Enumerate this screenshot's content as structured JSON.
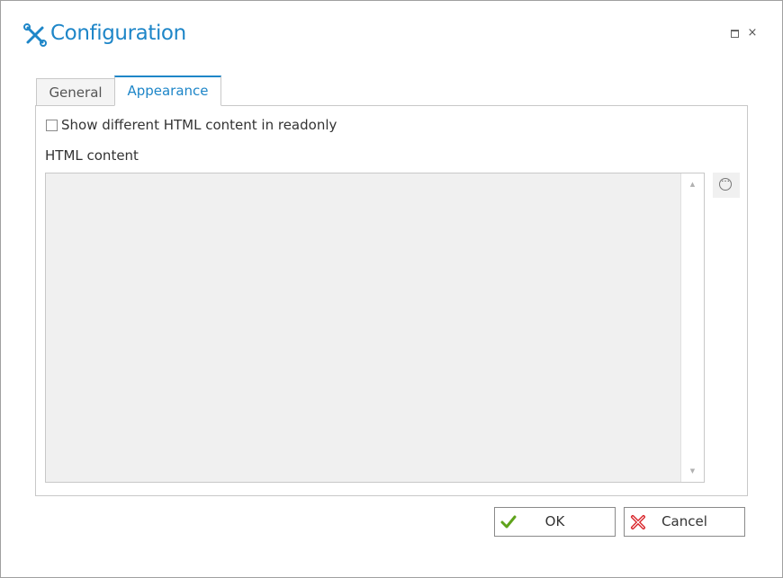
{
  "window": {
    "title": "Configuration",
    "icon": "tools-icon",
    "controls": {
      "maximize": "maximize-icon",
      "close_symbol": "×"
    }
  },
  "tabs": [
    {
      "label": "General",
      "active": false
    },
    {
      "label": "Appearance",
      "active": true
    }
  ],
  "appearance": {
    "checkbox_label": "Show different HTML content in readonly",
    "checkbox_checked": false,
    "html_content_label": "HTML content",
    "html_content_value": "",
    "scroll_up": "▲",
    "scroll_down": "▼",
    "editor_button_icon": "ellipsis-icon",
    "editor_button_symbol": "···"
  },
  "footer": {
    "ok_label": "OK",
    "cancel_label": "Cancel"
  },
  "colors": {
    "accent": "#1e86c8",
    "ok_icon": "#5fa31b",
    "cancel_icon": "#d9262b"
  }
}
